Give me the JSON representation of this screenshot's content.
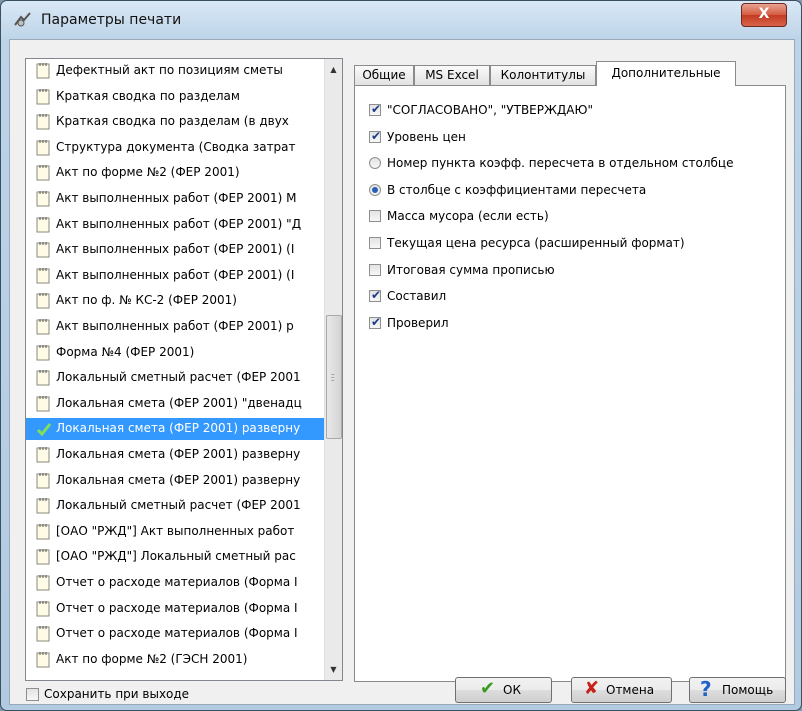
{
  "window": {
    "title": "Параметры печати",
    "close_label": "X"
  },
  "reports": [
    {
      "label": "Дефектный акт по позициям сметы",
      "selected": false
    },
    {
      "label": "Краткая сводка по разделам",
      "selected": false
    },
    {
      "label": "Краткая сводка по разделам (в двух",
      "selected": false
    },
    {
      "label": "Структура документа (Сводка затрат",
      "selected": false
    },
    {
      "label": "Акт по форме №2 (ФЕР 2001)",
      "selected": false
    },
    {
      "label": "Акт выполненных работ (ФЕР 2001) М",
      "selected": false
    },
    {
      "label": "Акт выполненных работ (ФЕР 2001) \"Д",
      "selected": false
    },
    {
      "label": "Акт выполненных работ (ФЕР 2001) (I",
      "selected": false
    },
    {
      "label": "Акт выполненных работ (ФЕР 2001) (I",
      "selected": false
    },
    {
      "label": "Акт по ф. № КС-2 (ФЕР 2001)",
      "selected": false
    },
    {
      "label": "Акт выполненных работ (ФЕР 2001) р",
      "selected": false
    },
    {
      "label": "Форма №4 (ФЕР 2001)",
      "selected": false
    },
    {
      "label": "Локальный сметный расчет (ФЕР 2001",
      "selected": false
    },
    {
      "label": "Локальная смета (ФЕР 2001) \"двенадц",
      "selected": false
    },
    {
      "label": "Локальная смета (ФЕР 2001) разверну",
      "selected": true
    },
    {
      "label": "Локальная смета (ФЕР 2001) разверну",
      "selected": false
    },
    {
      "label": "Локальная смета (ФЕР 2001) разверну",
      "selected": false
    },
    {
      "label": "Локальный сметный расчет (ФЕР 2001",
      "selected": false
    },
    {
      "label": "[ОАО \"РЖД\"] Акт выполненных работ",
      "selected": false
    },
    {
      "label": "[ОАО \"РЖД\"] Локальный сметный рас",
      "selected": false
    },
    {
      "label": "Отчет о расходе материалов (Форма I",
      "selected": false
    },
    {
      "label": "Отчет о расходе материалов (Форма I",
      "selected": false
    },
    {
      "label": "Отчет о расходе материалов (Форма I",
      "selected": false
    },
    {
      "label": "Акт по форме №2 (ГЭСН 2001)",
      "selected": false
    }
  ],
  "tabs": [
    {
      "label": "Общие",
      "active": false
    },
    {
      "label": "MS Excel",
      "active": false
    },
    {
      "label": "Колонтитулы",
      "active": false
    },
    {
      "label": "Дополнительные",
      "active": true
    }
  ],
  "options": [
    {
      "kind": "checkbox",
      "label": "\"СОГЛАСОВАНО\", \"УТВЕРЖДАЮ\"",
      "checked": true
    },
    {
      "kind": "checkbox",
      "label": "Уровень цен",
      "checked": true
    },
    {
      "kind": "radio",
      "label": "Номер пункта коэфф. пересчета в отдельном столбце",
      "checked": false
    },
    {
      "kind": "radio",
      "label": "В столбце с коэффициентами пересчета",
      "checked": true
    },
    {
      "kind": "checkbox",
      "label": "Масса мусора (если есть)",
      "checked": false
    },
    {
      "kind": "checkbox",
      "label": "Текущая цена ресурса (расширенный формат)",
      "checked": false
    },
    {
      "kind": "checkbox",
      "label": "Итоговая сумма прописью",
      "checked": false
    },
    {
      "kind": "checkbox",
      "label": "Составил",
      "checked": true
    },
    {
      "kind": "checkbox",
      "label": "Проверил",
      "checked": true
    }
  ],
  "footer": {
    "save_on_exit_label": "Сохранить при выходе",
    "save_on_exit_checked": false,
    "ok_label": "ОК",
    "cancel_label": "Отмена",
    "help_label": "Помощь"
  },
  "colors": {
    "selection": "#3399ff",
    "ok_check": "#3a9a1c",
    "cancel_x": "#c8201a",
    "help_q": "#1e64c8"
  }
}
